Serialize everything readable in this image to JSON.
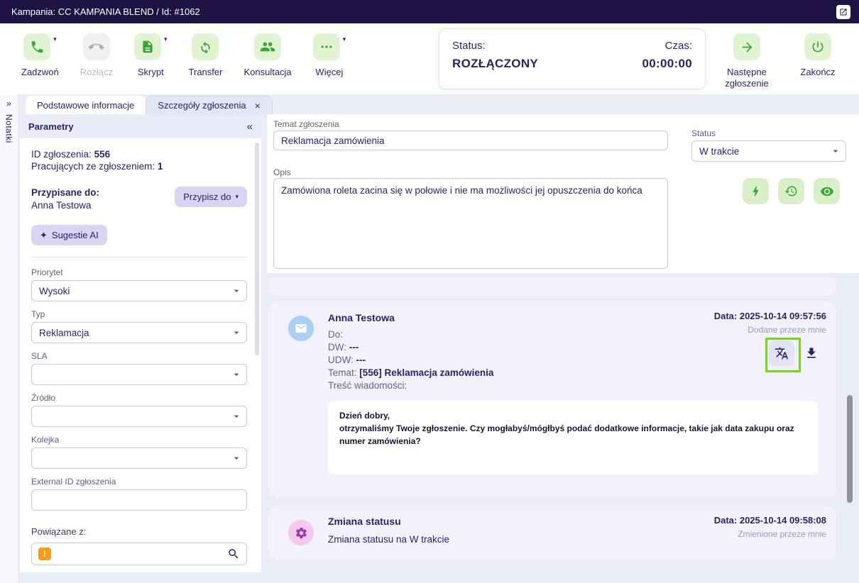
{
  "topbar": {
    "title": "Kampania: CC KAMPANIA BLEND / Id: #1062"
  },
  "icons": {
    "caret": "▾",
    "collapse_left": "«",
    "expand_right": "»",
    "close": "×",
    "sparkle": "✦",
    "exclaim": "!"
  },
  "toolbar": {
    "call": "Zadzwoń",
    "hangup": "Rozłącz",
    "script": "Skrypt",
    "transfer": "Transfer",
    "consult": "Konsultacja",
    "more": "Więcej",
    "status_label": "Status:",
    "status_value": "ROZŁĄCZONY",
    "time_label": "Czas:",
    "time_value": "00:00:00",
    "next_ticket": "Następne zgłoszenie",
    "finish": "Zakończ"
  },
  "rail": {
    "label": "Notatki"
  },
  "tabs": {
    "basic": "Podstawowe informacje",
    "details": "Szczegóły zgłoszenia"
  },
  "params": {
    "header": "Parametry",
    "id_label": "ID zgłoszenia:",
    "id_value": "556",
    "working_label": "Pracujących ze zgłoszeniem:",
    "working_value": "1",
    "assigned_label": "Przypisane do:",
    "assigned_name": "Anna Testowa",
    "assign_btn": "Przypisz do",
    "ai_btn": "Sugestie AI",
    "priority_label": "Priorytet",
    "priority_value": "Wysoki",
    "type_label": "Typ",
    "type_value": "Reklamacja",
    "sla_label": "SLA",
    "source_label": "Źródło",
    "queue_label": "Kolejka",
    "external_id_label": "External ID zgłoszenia",
    "related_label": "Powiązane z:"
  },
  "ticket": {
    "subject_label": "Temat zgłoszenia",
    "subject_value": "Reklamacja zamówienia",
    "status_label": "Status",
    "status_value": "W trakcie",
    "desc_label": "Opis",
    "desc_value": "Zamówiona roleta zacina się w połowie i nie ma możliwości jej opuszczenia do końca"
  },
  "timeline": {
    "email": {
      "author": "Anna Testowa",
      "date": "Data: 2025-10-14 09:57:56",
      "byline": "Dodane przeze mnie",
      "to_label": "Do:",
      "cc_label": "DW:",
      "cc_value": "---",
      "bcc_label": "UDW:",
      "bcc_value": "---",
      "subject_label": "Temat:",
      "subject_value": "[556] Reklamacja zamówienia",
      "body_label": "Treść wiadomości:",
      "body_line1": "Dzień dobry,",
      "body_line2": "otrzymaliśmy Twoje zgłoszenie. Czy mogłabyś/mógłbyś podać dodatkowe informacje, takie jak  data zakupu oraz numer zamówienia?"
    },
    "status_change": {
      "title": "Zmiana statusu",
      "text": "Zmiana statusu na W trakcie",
      "date": "Data: 2025-10-14 09:58:08",
      "byline": "Zmienione przeze mnie"
    }
  }
}
